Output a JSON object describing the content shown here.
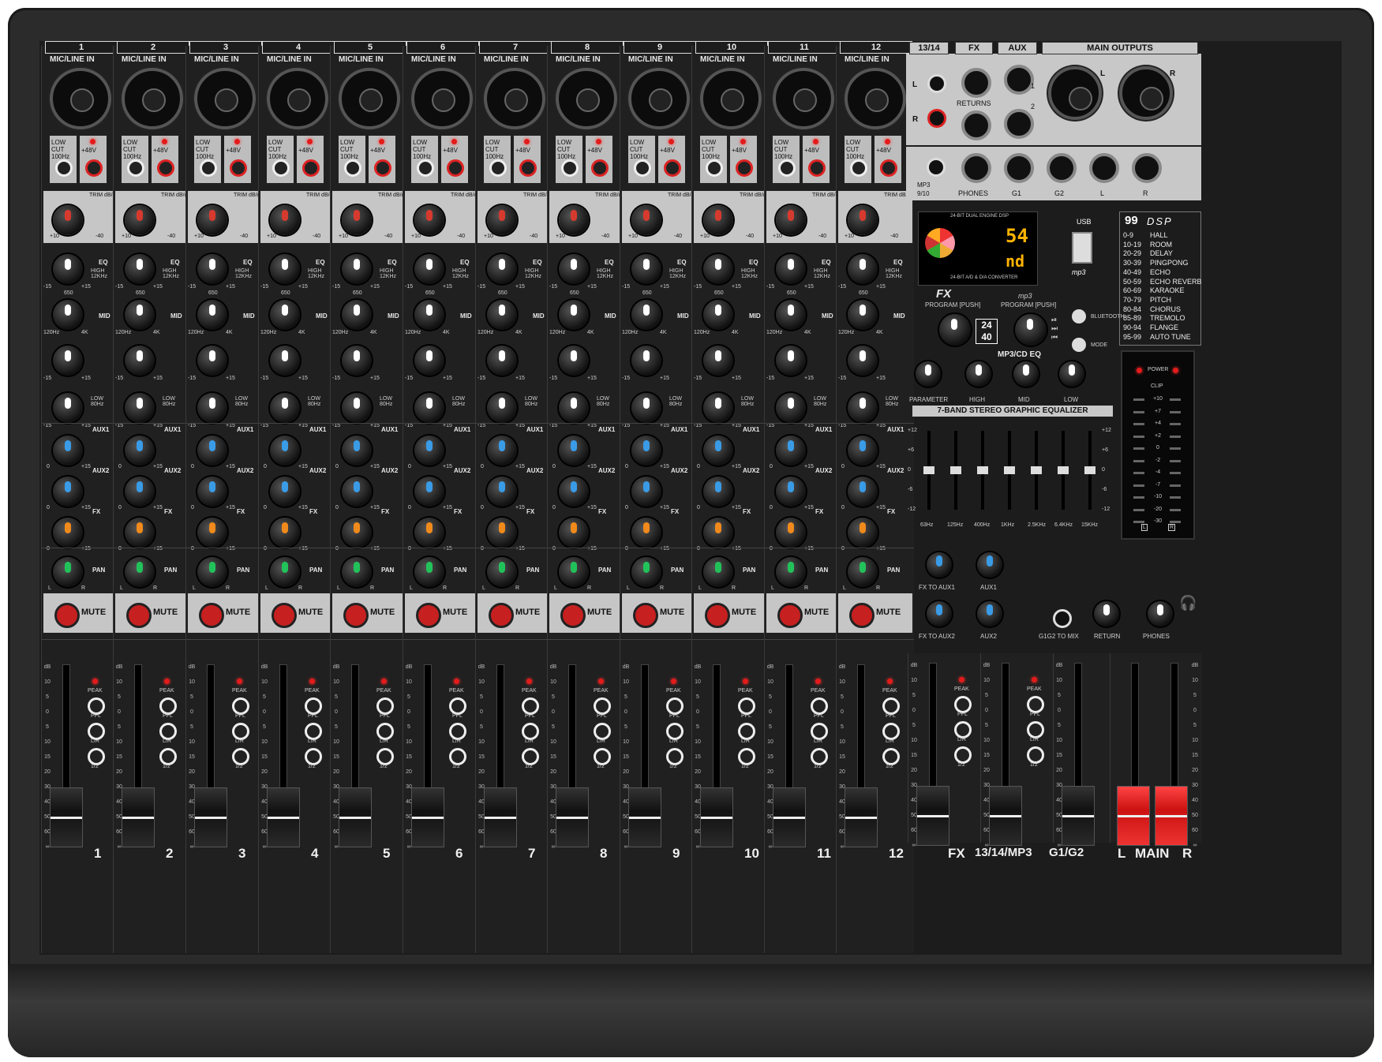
{
  "channels": [
    {
      "num": "1",
      "input": "MIC/LINE IN",
      "lowcut": "LOW CUT 100Hz",
      "phantom": "+48V",
      "trim": "TRIM dB/dBu",
      "eq": "EQ",
      "high": "HIGH 12KHz",
      "mid": "MID",
      "low": "LOW 80Hz",
      "aux1": "AUX1",
      "aux2": "AUX2",
      "fx": "FX",
      "pan": "PAN",
      "mute": "MUTE",
      "peak": "PEAK",
      "pfl": "PFL",
      "lr": "L/R",
      "g12": "1/2"
    },
    {
      "num": "2",
      "input": "MIC/LINE IN",
      "lowcut": "LOW CUT 100Hz",
      "phantom": "+48V",
      "trim": "TRIM dB/dBu",
      "eq": "EQ",
      "high": "HIGH 12KHz",
      "mid": "MID",
      "low": "LOW 80Hz",
      "aux1": "AUX1",
      "aux2": "AUX2",
      "fx": "FX",
      "pan": "PAN",
      "mute": "MUTE",
      "peak": "PEAK",
      "pfl": "PFL",
      "lr": "L/R",
      "g12": "1/2"
    },
    {
      "num": "3",
      "input": "MIC/LINE IN",
      "lowcut": "LOW CUT 100Hz",
      "phantom": "+48V",
      "trim": "TRIM dB/dBu",
      "eq": "EQ",
      "high": "HIGH 12KHz",
      "mid": "MID",
      "low": "LOW 80Hz",
      "aux1": "AUX1",
      "aux2": "AUX2",
      "fx": "FX",
      "pan": "PAN",
      "mute": "MUTE",
      "peak": "PEAK",
      "pfl": "PFL",
      "lr": "L/R",
      "g12": "1/2"
    },
    {
      "num": "4",
      "input": "MIC/LINE IN",
      "lowcut": "LOW CUT 100Hz",
      "phantom": "+48V",
      "trim": "TRIM dB/dBu",
      "eq": "EQ",
      "high": "HIGH 12KHz",
      "mid": "MID",
      "low": "LOW 80Hz",
      "aux1": "AUX1",
      "aux2": "AUX2",
      "fx": "FX",
      "pan": "PAN",
      "mute": "MUTE",
      "peak": "PEAK",
      "pfl": "PFL",
      "lr": "L/R",
      "g12": "1/2"
    },
    {
      "num": "5",
      "input": "MIC/LINE IN",
      "lowcut": "LOW CUT 100Hz",
      "phantom": "+48V",
      "trim": "TRIM dB/dBu",
      "eq": "EQ",
      "high": "HIGH 12KHz",
      "mid": "MID",
      "low": "LOW 80Hz",
      "aux1": "AUX1",
      "aux2": "AUX2",
      "fx": "FX",
      "pan": "PAN",
      "mute": "MUTE",
      "peak": "PEAK",
      "pfl": "PFL",
      "lr": "L/R",
      "g12": "1/2"
    },
    {
      "num": "6",
      "input": "MIC/LINE IN",
      "lowcut": "LOW CUT 100Hz",
      "phantom": "+48V",
      "trim": "TRIM dB/dBu",
      "eq": "EQ",
      "high": "HIGH 12KHz",
      "mid": "MID",
      "low": "LOW 80Hz",
      "aux1": "AUX1",
      "aux2": "AUX2",
      "fx": "FX",
      "pan": "PAN",
      "mute": "MUTE",
      "peak": "PEAK",
      "pfl": "PFL",
      "lr": "L/R",
      "g12": "1/2"
    },
    {
      "num": "7",
      "input": "MIC/LINE IN",
      "lowcut": "LOW CUT 100Hz",
      "phantom": "+48V",
      "trim": "TRIM dB/dBu",
      "eq": "EQ",
      "high": "HIGH 12KHz",
      "mid": "MID",
      "low": "LOW 80Hz",
      "aux1": "AUX1",
      "aux2": "AUX2",
      "fx": "FX",
      "pan": "PAN",
      "mute": "MUTE",
      "peak": "PEAK",
      "pfl": "PFL",
      "lr": "L/R",
      "g12": "1/2"
    },
    {
      "num": "8",
      "input": "MIC/LINE IN",
      "lowcut": "LOW CUT 100Hz",
      "phantom": "+48V",
      "trim": "TRIM dB/dBu",
      "eq": "EQ",
      "high": "HIGH 12KHz",
      "mid": "MID",
      "low": "LOW 80Hz",
      "aux1": "AUX1",
      "aux2": "AUX2",
      "fx": "FX",
      "pan": "PAN",
      "mute": "MUTE",
      "peak": "PEAK",
      "pfl": "PFL",
      "lr": "L/R",
      "g12": "1/2"
    },
    {
      "num": "9",
      "input": "MIC/LINE IN",
      "lowcut": "LOW CUT 100Hz",
      "phantom": "+48V",
      "trim": "TRIM dB/dBu",
      "eq": "EQ",
      "high": "HIGH 12KHz",
      "mid": "MID",
      "low": "LOW 80Hz",
      "aux1": "AUX1",
      "aux2": "AUX2",
      "fx": "FX",
      "pan": "PAN",
      "mute": "MUTE",
      "peak": "PEAK",
      "pfl": "PFL",
      "lr": "L/R",
      "g12": "1/2"
    },
    {
      "num": "10",
      "input": "MIC/LINE IN",
      "lowcut": "LOW CUT 100Hz",
      "phantom": "+48V",
      "trim": "TRIM dB/dBu",
      "eq": "EQ",
      "high": "HIGH 12KHz",
      "mid": "MID",
      "low": "LOW 80Hz",
      "aux1": "AUX1",
      "aux2": "AUX2",
      "fx": "FX",
      "pan": "PAN",
      "mute": "MUTE",
      "peak": "PEAK",
      "pfl": "PFL",
      "lr": "L/R",
      "g12": "1/2"
    },
    {
      "num": "11",
      "input": "MIC/LINE IN",
      "lowcut": "LOW CUT 100Hz",
      "phantom": "+48V",
      "trim": "TRIM dB/dBu",
      "eq": "EQ",
      "high": "HIGH 12KHz",
      "mid": "MID",
      "low": "LOW 80Hz",
      "aux1": "AUX1",
      "aux2": "AUX2",
      "fx": "FX",
      "pan": "PAN",
      "mute": "MUTE",
      "peak": "PEAK",
      "pfl": "PFL",
      "lr": "L/R",
      "g12": "1/2"
    },
    {
      "num": "12",
      "input": "MIC/LINE IN",
      "lowcut": "LOW CUT 100Hz",
      "phantom": "+48V",
      "trim": "TRIM dB/dBu",
      "eq": "EQ",
      "high": "HIGH 12KHz",
      "mid": "MID",
      "low": "LOW 80Hz",
      "aux1": "AUX1",
      "aux2": "AUX2",
      "fx": "FX",
      "pan": "PAN",
      "mute": "MUTE",
      "peak": "PEAK",
      "pfl": "PFL",
      "lr": "L/R",
      "g12": "1/2"
    }
  ],
  "knob_scales": {
    "trim_min": "+10",
    "trim_max": "-40",
    "eq_min": "-15",
    "eq_max": "+15",
    "mid_min": "120Hz",
    "mid_max": "4K",
    "mid_center": "650",
    "send_min": "0",
    "send_max": "+15",
    "pan_l": "L",
    "pan_r": "R"
  },
  "fader_scale": [
    "dB",
    "10",
    "5",
    "0",
    "5",
    "10",
    "15",
    "20",
    "30",
    "40",
    "50",
    "60",
    "∞"
  ],
  "rear": {
    "tab_1314": "13/14",
    "tab_fx": "FX",
    "tab_aux": "AUX",
    "tab_main": "MAIN OUTPUTS",
    "l": "L",
    "r": "R",
    "returns": "RETURNS",
    "aux_1": "1",
    "aux_2": "2",
    "mp3_label": "MP3",
    "ch910_label": "9/10",
    "phones": "PHONES",
    "g1": "G1",
    "g2": "G2",
    "out_l": "L",
    "out_r": "R"
  },
  "dsp": {
    "display_top": "24-BIT DUAL ENGINE DSP",
    "display_bottom": "24-BIT A/D & D/A CONVERTER",
    "readout1": "54",
    "readout2": "nd",
    "usb": "USB",
    "mp3_logo": "mp3",
    "fx_label": "FX",
    "fx_program": "PROGRAM [PUSH]",
    "mp3_program": "PROGRAM [PUSH]",
    "bit_badge_top": "24",
    "bit_badge_bottom": "40",
    "mp3cd_eq": "MP3/CD EQ",
    "bluetooth": "BLUETOOTH",
    "mode": "MODE",
    "parameter": "PARAMETER",
    "high": "HIGH",
    "mid": "MID",
    "low": "LOW",
    "dsp_title_num": "99",
    "dsp_title": "DSP",
    "presets": [
      {
        "range": "0-9",
        "name": "HALL"
      },
      {
        "range": "10-19",
        "name": "ROOM"
      },
      {
        "range": "20-29",
        "name": "DELAY"
      },
      {
        "range": "30-39",
        "name": "PINGPONG"
      },
      {
        "range": "40-49",
        "name": "ECHO"
      },
      {
        "range": "50-59",
        "name": "ECHO REVERB"
      },
      {
        "range": "60-69",
        "name": "KARAOKE"
      },
      {
        "range": "70-79",
        "name": "PITCH"
      },
      {
        "range": "80-84",
        "name": "CHORUS"
      },
      {
        "range": "85-89",
        "name": "TREMOLO"
      },
      {
        "range": "90-94",
        "name": "FLANGE"
      },
      {
        "range": "95-99",
        "name": "AUTO TUNE"
      }
    ]
  },
  "geq": {
    "title": "7-BAND STEREO GRAPHIC EQUALIZER",
    "scale": [
      "+12",
      "+6",
      "0",
      "-6",
      "-12"
    ],
    "bands": [
      {
        "freq": "63Hz",
        "value": 0
      },
      {
        "freq": "125Hz",
        "value": 0
      },
      {
        "freq": "400Hz",
        "value": 0
      },
      {
        "freq": "1KHz",
        "value": 0
      },
      {
        "freq": "2.5KHz",
        "value": 0
      },
      {
        "freq": "6.4KHz",
        "value": 0
      },
      {
        "freq": "15KHz",
        "value": 0
      }
    ]
  },
  "meter": {
    "power": "POWER",
    "clip": "CLIP",
    "levels": [
      "+10",
      "+7",
      "+4",
      "+2",
      "0",
      "-2",
      "-4",
      "-7",
      "-10",
      "-20",
      "-30"
    ],
    "left": "L",
    "right": "R"
  },
  "aux_section": {
    "fx_to_aux1": "FX TO AUX1",
    "aux1": "AUX1",
    "fx_to_aux2": "FX TO AUX2",
    "aux2": "AUX2",
    "g1g2_to_mix": "G1G2 TO MIX",
    "return": "RETURN",
    "phones": "PHONES"
  },
  "master_strips": [
    {
      "label": "FX",
      "peak": "PEAK",
      "pfl": "PFL",
      "lr": "L/R",
      "g12": "1/2"
    },
    {
      "label": "13/14/MP3",
      "peak": "PEAK",
      "pfl": "PFL",
      "lr": "L/R",
      "g12": "1/2"
    },
    {
      "label": "G1/G2"
    }
  ],
  "main_label": {
    "l": "L",
    "main": "MAIN",
    "r": "R"
  },
  "colors": {
    "body": "#2b2b2b",
    "panel": "#1c1c1c",
    "metal": "#c6c6c6",
    "mute_red": "#c62020",
    "display_amber": "#ffb400",
    "main_fader_red": "#e33"
  }
}
